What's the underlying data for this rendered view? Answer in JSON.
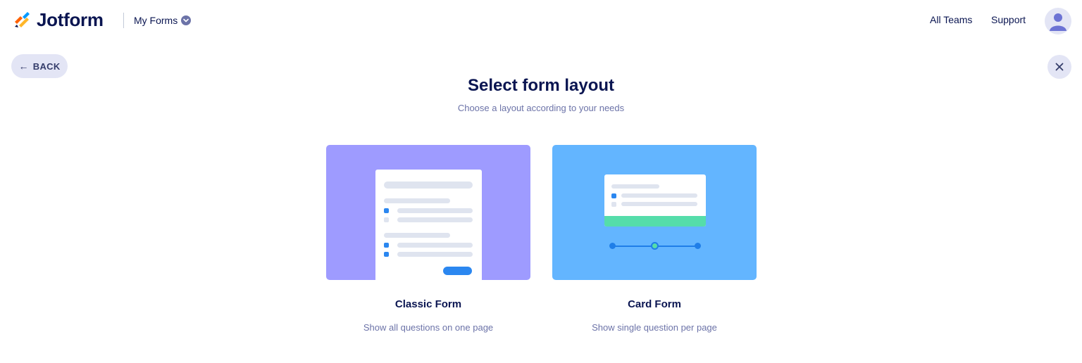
{
  "header": {
    "brand": "Jotform",
    "my_forms": "My Forms",
    "nav": {
      "all_teams": "All Teams",
      "support": "Support"
    }
  },
  "back_button": {
    "label": "BACK",
    "icon": "arrow-left-icon"
  },
  "close_button": {
    "icon": "close-icon"
  },
  "page": {
    "title": "Select form layout",
    "subtitle": "Choose a layout according to your needs"
  },
  "layouts": [
    {
      "id": "classic",
      "title": "Classic Form",
      "description": "Show all questions on one page",
      "color": "#9e9bff"
    },
    {
      "id": "card",
      "title": "Card Form",
      "description": "Show single question per page",
      "color": "#63b5ff"
    }
  ],
  "colors": {
    "text_primary": "#0a1551",
    "text_secondary": "#6c73a8",
    "button_bg": "#e3e5f5",
    "accent_blue": "#2b87f0",
    "accent_green": "#55ddaa",
    "brand_orange": "#ff6100",
    "brand_yellow": "#ffb629",
    "brand_blue": "#0099ff"
  }
}
